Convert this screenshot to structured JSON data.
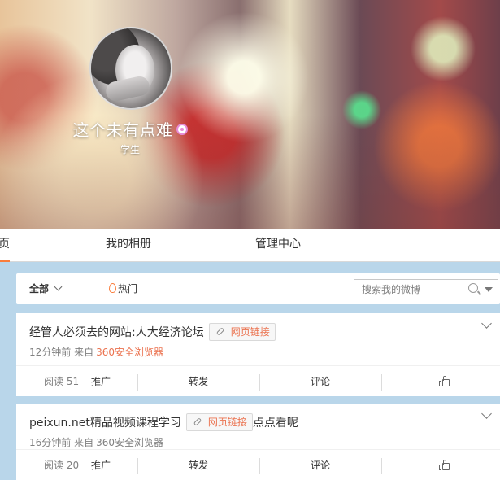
{
  "profile": {
    "name": "这个未有点难",
    "role": "学生"
  },
  "nav": {
    "home": "首页",
    "album": "我的相册",
    "manage": "管理中心"
  },
  "filter": {
    "all": "全部",
    "hot": "热门",
    "search_placeholder": "搜索我的微博"
  },
  "posts": [
    {
      "text": "经管人必须去的网站:人大经济论坛",
      "link_label": "网页链接",
      "after_text": "",
      "time": "12分钟前",
      "from_label": "来自",
      "source": "360安全浏览器",
      "reads": "阅读 51",
      "promote": "推广",
      "repost": "转发",
      "comment": "评论"
    },
    {
      "text": "peixun.net精品视频课程学习",
      "link_label": "网页链接",
      "after_text": "点点看呢",
      "time": "16分钟前",
      "from_label": "来自",
      "source": "360安全浏览器",
      "reads": "阅读 20",
      "promote": "推广",
      "repost": "转发",
      "comment": "评论"
    }
  ],
  "colors": {
    "accent": "#fa7d3c",
    "link": "#eb7350",
    "page_bg": "#b9d6ea"
  }
}
